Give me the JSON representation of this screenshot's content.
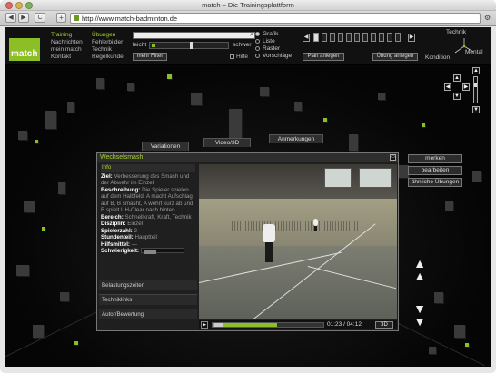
{
  "browser": {
    "window_title": "match – Die Trainingsplattform",
    "back_label": "◀",
    "forward_label": "▶",
    "reload_label": "C",
    "add_label": "+",
    "url": "http://www.match-badminton.de"
  },
  "header": {
    "logo": "match",
    "nav_main": [
      "Training",
      "Nachrichten",
      "mein match",
      "Kontakt"
    ],
    "nav_sub": [
      "Übungen",
      "Fehlerbilder",
      "Technik",
      "Regelkunde"
    ],
    "search_placeholder": "",
    "slider_left": "leicht",
    "slider_right": "schwer",
    "filter_button": "mehr Filter",
    "hilfe_label": "Hilfe",
    "view_options": [
      "Grafik",
      "Liste",
      "Raster",
      "Vorschläge"
    ],
    "view_selected": "Grafik",
    "plan_button": "Plan anlegen",
    "uebung_button": "Übung anlegen",
    "triangle_labels": {
      "top": "Technik",
      "left": "Kondition",
      "right": "Mental"
    },
    "accent_color": "#8cbf26"
  },
  "tabs": [
    "Variationen",
    "Video/3D",
    "Anmerkungen"
  ],
  "panel": {
    "title": "Wechselsmash",
    "info_heading": "Info",
    "ziel_label": "Ziel:",
    "ziel_text": "Verbesserung des Smash und der Abwehr im Einzel",
    "beschreibung_label": "Beschreibung:",
    "beschreibung_text": "Die Spieler spielen auf dem Halbfeld. A macht Aufschlag auf B, B smasht, A wehrt kurz ab und B spielt UH-Clear nach hinten.",
    "bereich_label": "Bereich:",
    "bereich_text": "Schnellkraft, Kraft, Technik",
    "disziplin_label": "Disziplin:",
    "disziplin_text": "Einzel",
    "spielerzahl_label": "Spielerzahl:",
    "spielerzahl_text": "2",
    "stundenteil_label": "Stundenteil:",
    "stundenteil_text": "Hauptteil",
    "hilfsmittel_label": "Hilfsmittel:",
    "hilfsmittel_text": "—",
    "schwierigkeit_label": "Schwierigkeit:",
    "accordion": [
      "Belastungszeiten",
      "Techniklinks",
      "Autor/Bewertung"
    ],
    "video_time": "01:23 / 04:12",
    "video_progress": 0.58,
    "button_3d": "3D",
    "play_icon": "▶"
  },
  "side_buttons": [
    "merken",
    "bearbeiten",
    "ähnliche Übungen"
  ]
}
